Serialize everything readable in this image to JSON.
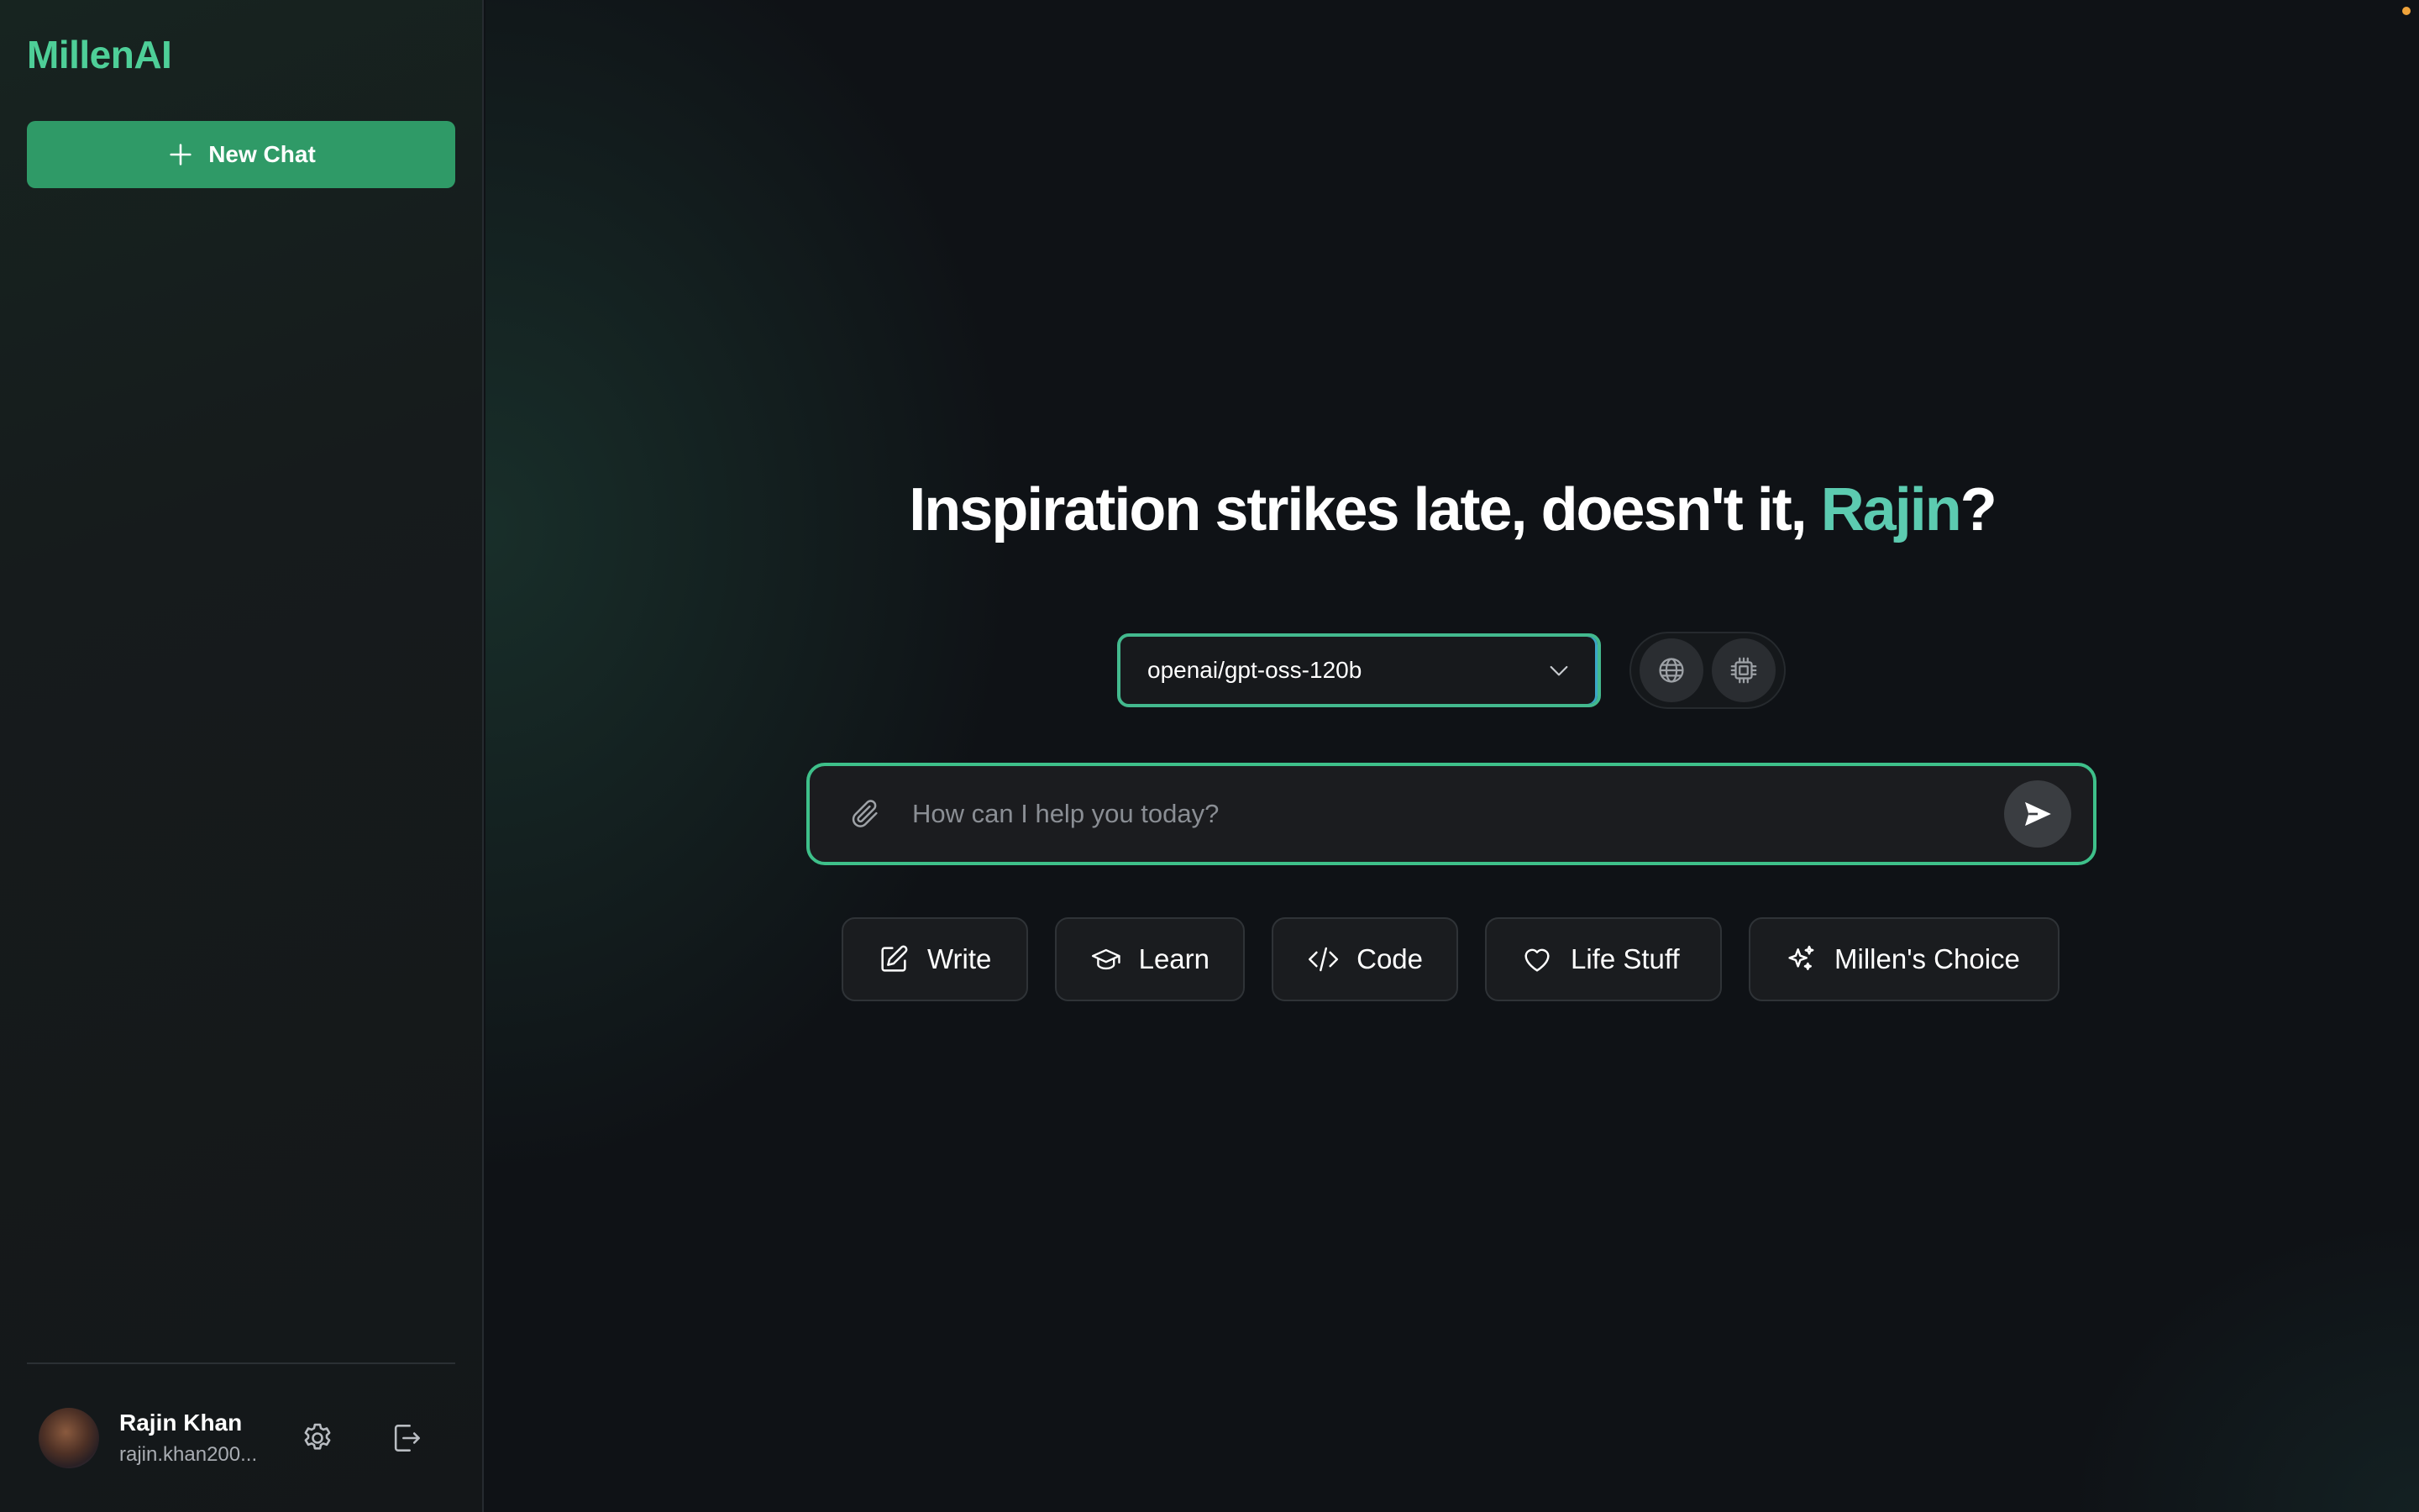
{
  "app": {
    "name": "MillenAI"
  },
  "sidebar": {
    "new_chat_label": "New Chat",
    "new_chat_icon": "plus-icon",
    "user": {
      "name": "Rajin Khan",
      "email": "rajin.khan200..."
    },
    "settings_icon": "gear-icon",
    "logout_icon": "logout-icon"
  },
  "main": {
    "headline_prefix": "Inspiration strikes late, doesn't it, ",
    "headline_name": "Rajin",
    "headline_suffix": "?",
    "model_selector": {
      "value": "openai/gpt-oss-120b",
      "icon": "chevron-down-icon"
    },
    "toggles": [
      {
        "name": "web-search",
        "icon": "globe-icon"
      },
      {
        "name": "model-processor",
        "icon": "chip-icon"
      }
    ],
    "input": {
      "placeholder": "How can I help you today?",
      "value": ""
    },
    "chips": [
      {
        "label": "Write",
        "icon": "pencil-icon"
      },
      {
        "label": "Learn",
        "icon": "graduation-cap-icon"
      },
      {
        "label": "Code",
        "icon": "code-icon"
      },
      {
        "label": "Life Stuff",
        "icon": "heart-icon"
      },
      {
        "label": "Millen's Choice",
        "icon": "sparkles-icon"
      }
    ]
  },
  "colors": {
    "brand": "#4ecf98",
    "button_green": "#2f9a67",
    "accent_name": "#5ccbb0",
    "background": "#0f1216"
  }
}
